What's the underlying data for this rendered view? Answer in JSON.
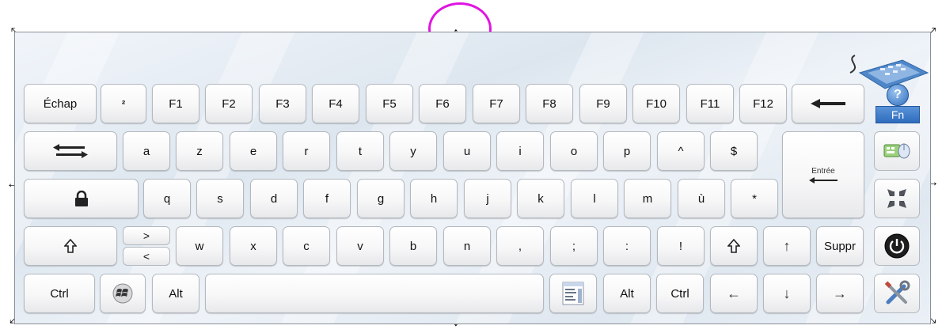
{
  "keyboard": {
    "row1": [
      "Échap",
      "²",
      "F1",
      "F2",
      "F3",
      "F4",
      "F5",
      "F6",
      "F7",
      "F8",
      "F9",
      "F10",
      "F11",
      "F12"
    ],
    "row2": [
      "a",
      "z",
      "e",
      "r",
      "t",
      "y",
      "u",
      "i",
      "o",
      "p",
      "^",
      "$"
    ],
    "row3": [
      "q",
      "s",
      "d",
      "f",
      "g",
      "h",
      "j",
      "k",
      "l",
      "m",
      "ù",
      "*"
    ],
    "row4": [
      ">",
      "<",
      "w",
      "x",
      "c",
      "v",
      "b",
      "n",
      ",",
      ";",
      ":",
      "!",
      "↑",
      "Suppr"
    ],
    "row5": [
      "Ctrl",
      "Alt",
      "Alt",
      "Ctrl",
      "←",
      "↓",
      "→"
    ],
    "enter_label": "Entrée",
    "fn_label": "Fn",
    "help_glyph": "?"
  },
  "icons": [
    "backspace-arrow-icon",
    "tab-arrows-icon",
    "caps-lock-padlock-icon",
    "shift-arrow-icon",
    "windows-logo-icon",
    "context-menu-icon",
    "enter-arrow-icon",
    "help-icon",
    "keyboard-mouse-settings-icon",
    "dock-arrows-icon",
    "power-icon",
    "tools-icon",
    "resize-handle-icon"
  ],
  "colors": {
    "highlight_circle": "#e016e0",
    "fn_button": "#3a78c8",
    "power_button": "#1d1d1d",
    "frame_border": "#8a9099"
  }
}
